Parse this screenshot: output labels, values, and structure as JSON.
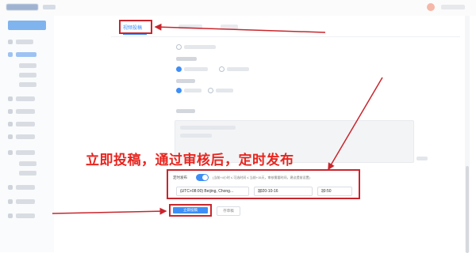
{
  "tabs": {
    "active_label": "视频投稿"
  },
  "overlay": {
    "caption": "立即投稿，通过审核后，定时发布"
  },
  "schedule": {
    "label": "定时发布",
    "note": "(当前+4小时 ≤ 可选时间 ≤ 当前+15天，审核需要时间，建议提前设置)",
    "timezone": "(UTC+08:00) Beijing, Chong...",
    "date": "2020-10-16",
    "time": "20:50",
    "toggle_on": true
  },
  "actions": {
    "publish_label": "立即投稿",
    "secondary_label": "存草稿"
  },
  "colors": {
    "accent": "#3e8ef7",
    "annotation_red": "#c8262d",
    "caption_red": "#e8251f"
  }
}
